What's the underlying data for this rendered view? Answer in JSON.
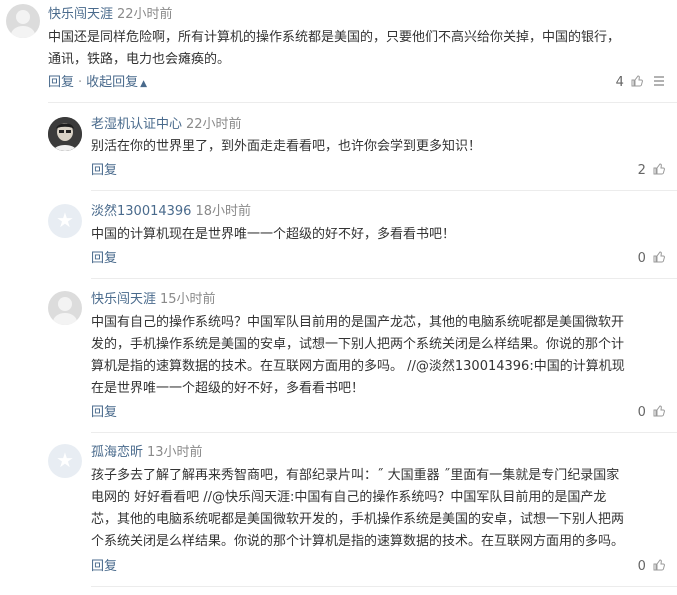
{
  "comments": [
    {
      "author": "快乐闯天涯",
      "time": "22小时前",
      "lines": [
        "中国还是同样危险啊，所有计算机的操作系统都是美国的，只要他们不高兴给你关掉，中国的银行，",
        "通讯，铁路，电力也会瘫痪的。"
      ],
      "reply_label": "回复",
      "collapse_label": "收起回复",
      "likes": "4"
    },
    {
      "author": "老湿机认证中心",
      "time": "22小时前",
      "lines": [
        "别活在你的世界里了，到外面走走看看吧，也许你会学到更多知识！"
      ],
      "reply_label": "回复",
      "likes": "2"
    },
    {
      "author": "淡然130014396",
      "time": "18小时前",
      "lines": [
        "中国的计算机现在是世界唯一一个超级的好不好，多看看书吧！"
      ],
      "reply_label": "回复",
      "likes": "0"
    },
    {
      "author": "快乐闯天涯",
      "time": "15小时前",
      "lines": [
        "中国有自己的操作系统吗？中国军队目前用的是国产龙芯，其他的电脑系统呢都是美国微软开",
        "发的，手机操作系统是美国的安卓，试想一下别人把两个系统关闭是么样结果。你说的那个计",
        "算机是指的速算数据的技术。在互联网方面用的多吗。 //@淡然130014396:中国的计算机现",
        "在是世界唯一一个超级的好不好，多看看书吧！"
      ],
      "reply_label": "回复",
      "likes": "0"
    },
    {
      "author": "孤海恋昕",
      "time": "13小时前",
      "lines": [
        "孩子多去了解了解再来秀智商吧，有部纪录片叫：˝ 大国重器 ˝里面有一集就是专门纪录国家",
        "电网的 好好看看吧 //@快乐闯天涯:中国有自己的操作系统吗？中国军队目前用的是国产龙",
        "芯，其他的电脑系统呢都是美国微软开发的，手机操作系统是美国的安卓，试想一下别人把两",
        "个系统关闭是么样结果。你说的那个计算机是指的速算数据的技术。在互联网方面用的多吗。"
      ],
      "reply_label": "回复",
      "likes": "0"
    }
  ],
  "colors": {
    "author": "#496a8c",
    "text": "#333333",
    "muted": "#8a8a8a"
  }
}
